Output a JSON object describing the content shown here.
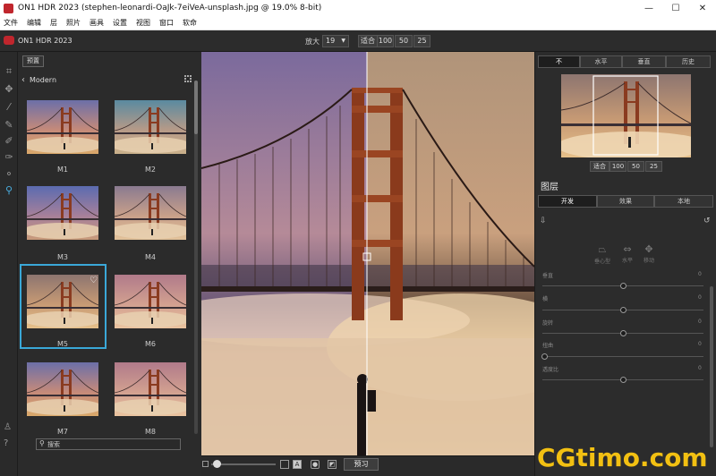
{
  "window": {
    "title": "ON1 HDR 2023 (stephen-leonardi-OaJk-7eiVeA-unsplash.jpg @ 19.0% 8-bit)",
    "min": "—",
    "max": "☐",
    "close": "✕"
  },
  "menu": [
    "文件",
    "编辑",
    "层",
    "照片",
    "画具",
    "设置",
    "视图",
    "窗口",
    "软命"
  ],
  "app": {
    "name": "ON1 HDR 2023"
  },
  "zoom": {
    "label": "放大",
    "value": "19",
    "fit": "适合",
    "z100": "100",
    "z50": "50",
    "z25": "25"
  },
  "presets": {
    "button": "预置",
    "category": "Modern",
    "items": [
      {
        "label": "M1"
      },
      {
        "label": "M2"
      },
      {
        "label": "M3"
      },
      {
        "label": "M4"
      },
      {
        "label": "M5",
        "selected": true
      },
      {
        "label": "M6"
      },
      {
        "label": "M7"
      },
      {
        "label": "M8"
      }
    ],
    "search_placeholder": "搜索"
  },
  "preview": {
    "button": "预习"
  },
  "compare_tabs": [
    "不",
    "水平",
    "垂直",
    "历史"
  ],
  "navigator": {
    "fit": "适合",
    "z100": "100",
    "z50": "50",
    "z25": "25"
  },
  "layers": {
    "title": "图层",
    "tabs": [
      "开发",
      "效果",
      "本地"
    ],
    "controls": [
      {
        "icon": "trapezoid-icon",
        "label": "垂心型"
      },
      {
        "icon": "horizontal-icon",
        "label": "水平"
      },
      {
        "icon": "move-icon",
        "label": "移动"
      }
    ],
    "sliders": [
      {
        "label": "垂直",
        "value": "0"
      },
      {
        "label": "横",
        "value": "0"
      },
      {
        "label": "旋转",
        "value": "0"
      },
      {
        "label": "扭曲",
        "value": "0"
      },
      {
        "label": "透度比",
        "value": "0"
      }
    ]
  },
  "watermark": "CGtimo.com",
  "colors": {
    "accent": "#3aa8d8",
    "brand": "#c0262d",
    "watermark": "#f2c012"
  }
}
